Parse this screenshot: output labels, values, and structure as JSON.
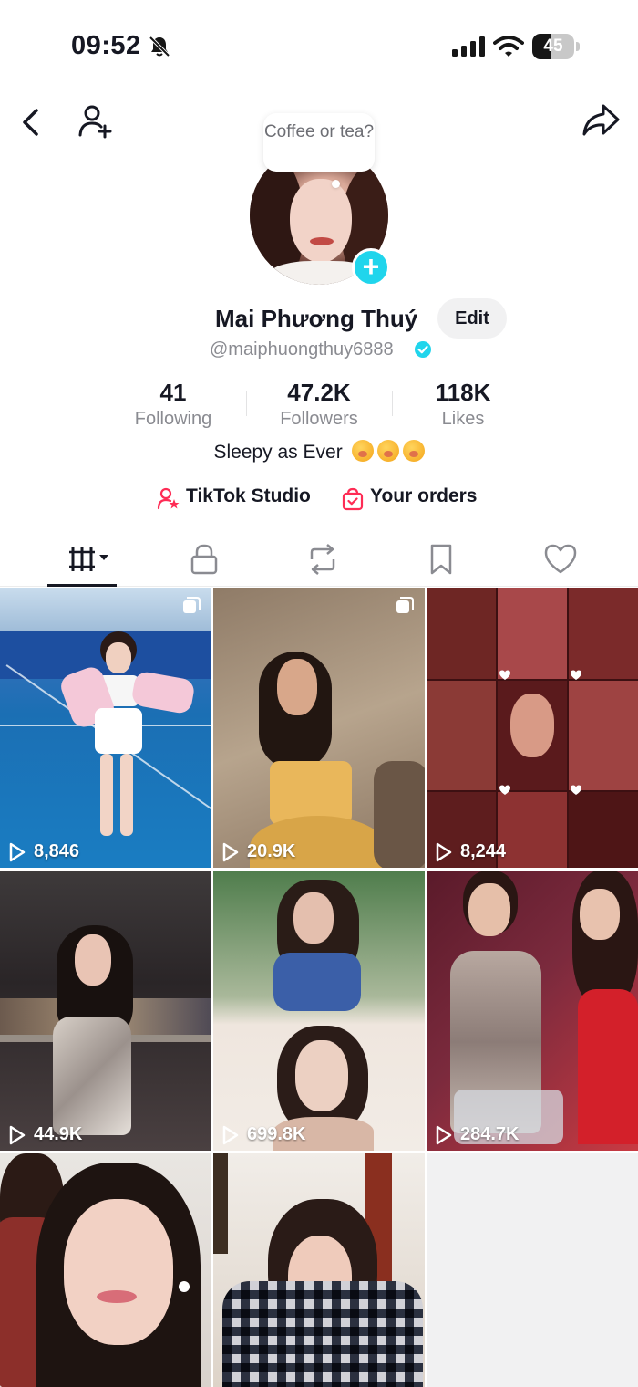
{
  "status_bar": {
    "time": "09:52",
    "battery_level": "45",
    "battery_fraction": 0.45,
    "icons": [
      "bell-slash-icon",
      "signal-icon",
      "wifi-icon",
      "battery-icon"
    ]
  },
  "nav": {
    "icons": [
      "chevron-left-icon",
      "add-user-icon",
      "share-icon"
    ]
  },
  "profile": {
    "note_bubble": "Coffee or tea?",
    "display_name": "Mai Phương Thuý",
    "edit_label": "Edit",
    "username": "@maiphuongthuy6888",
    "verified": true,
    "bio": "Sleepy as Ever"
  },
  "stats": [
    {
      "value": "41",
      "label": "Following"
    },
    {
      "value": "47.2K",
      "label": "Followers"
    },
    {
      "value": "118K",
      "label": "Likes"
    }
  ],
  "links": {
    "studio": "TikTok Studio",
    "orders": "Your orders"
  },
  "tabs": [
    "videos-grid-icon",
    "lock-icon",
    "repost-icon",
    "bookmark-icon",
    "heart-icon"
  ],
  "videos": [
    {
      "views": "8,846",
      "multi": true
    },
    {
      "views": "20.9K",
      "multi": true
    },
    {
      "views": "8,244",
      "multi": false
    },
    {
      "views": "44.9K",
      "multi": false
    },
    {
      "views": "699.8K",
      "multi": false
    },
    {
      "views": "284.7K",
      "multi": false
    },
    {
      "views": "",
      "multi": false
    },
    {
      "views": "",
      "multi": false
    }
  ],
  "colors": {
    "accent": "#20d5ec",
    "verified": "#20d5ec",
    "text_primary": "#161823",
    "text_secondary": "#8a8b91",
    "link_icon": "#fe2c55"
  }
}
